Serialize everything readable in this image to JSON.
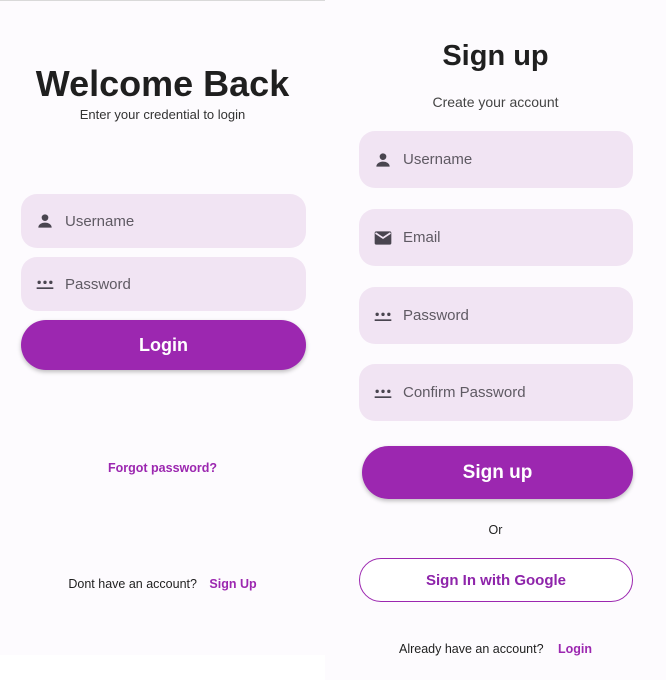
{
  "login": {
    "title": "Welcome Back",
    "subtitle": "Enter your credential to login",
    "username_placeholder": "Username",
    "password_placeholder": "Password",
    "login_button": "Login",
    "forgot_password": "Forgot password?",
    "no_account_text": "Dont have an account?",
    "sign_up_link": "Sign Up"
  },
  "signup": {
    "title": "Sign up",
    "subtitle": "Create your account",
    "username_placeholder": "Username",
    "email_placeholder": "Email",
    "password_placeholder": "Password",
    "confirm_password_placeholder": "Confirm Password",
    "signup_button": "Sign up",
    "or_text": "Or",
    "google_button": "Sign In with Google",
    "have_account_text": "Already have an account?",
    "login_link": "Login"
  },
  "colors": {
    "accent": "#9c27b0",
    "field_background": "#f1e4f3",
    "screen_background": "#fdfbfe"
  },
  "icons": [
    "person-icon",
    "password-dots-icon",
    "email-icon"
  ]
}
